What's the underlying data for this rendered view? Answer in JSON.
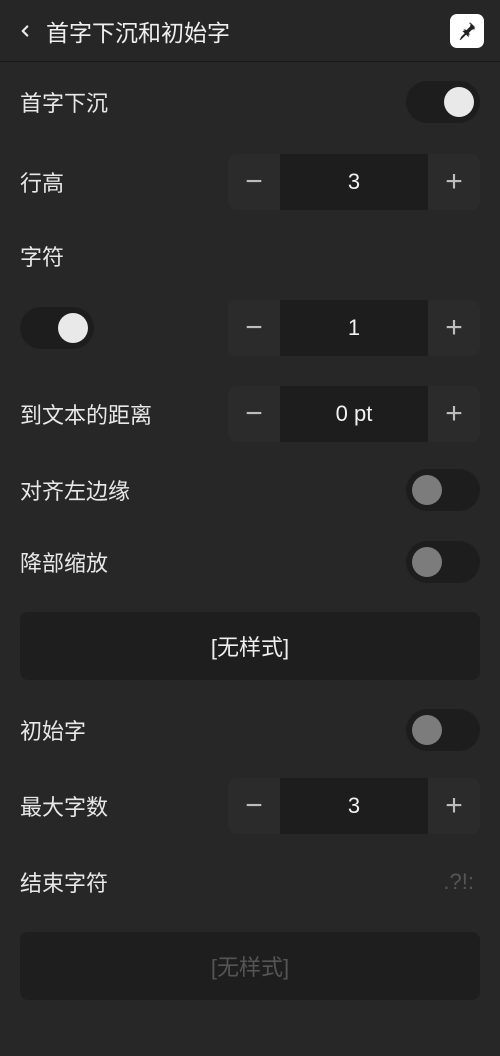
{
  "header": {
    "title": "首字下沉和初始字"
  },
  "rows": {
    "drop_cap": {
      "label": "首字下沉",
      "on": true
    },
    "line_height": {
      "label": "行高",
      "value": "3"
    },
    "chars": {
      "label": "字符"
    },
    "chars_count": {
      "value": "1",
      "toggle_on": true
    },
    "distance": {
      "label": "到文本的距离",
      "value": "0 pt"
    },
    "align_left": {
      "label": "对齐左边缘",
      "on": false
    },
    "descender_scale": {
      "label": "降部缩放",
      "on": false
    },
    "style_none_1": "[无样式]",
    "initial": {
      "label": "初始字",
      "on": false
    },
    "max_chars": {
      "label": "最大字数",
      "value": "3"
    },
    "end_chars": {
      "label": "结束字符",
      "placeholder": ".?!:"
    },
    "style_none_2": "[无样式]"
  }
}
